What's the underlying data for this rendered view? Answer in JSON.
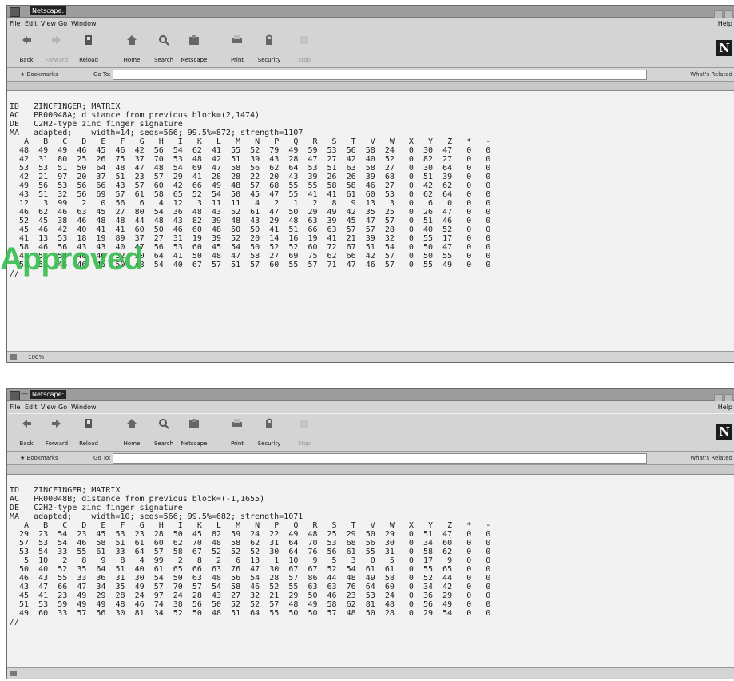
{
  "window_top": {
    "title": "Netscape:",
    "menu": [
      "File",
      "Edit",
      "View",
      "Go",
      "Window"
    ],
    "help": "Help",
    "toolbar": [
      {
        "label": "Back",
        "icon": "back-arrow-icon",
        "enabled": true
      },
      {
        "label": "Forward",
        "icon": "forward-arrow-icon",
        "enabled": false
      },
      {
        "label": "Reload",
        "icon": "reload-icon",
        "enabled": true
      },
      {
        "label": "Home",
        "icon": "home-icon",
        "enabled": true
      },
      {
        "label": "Search",
        "icon": "search-icon",
        "enabled": true
      },
      {
        "label": "Netscape",
        "icon": "netscape-icon",
        "enabled": true
      },
      {
        "label": "Print",
        "icon": "print-icon",
        "enabled": true
      },
      {
        "label": "Security",
        "icon": "security-lock-icon",
        "enabled": true
      },
      {
        "label": "Stop",
        "icon": "stop-icon",
        "enabled": false
      }
    ],
    "bookmarks": "Bookmarks",
    "goto": "Go To:",
    "related": "What's Related",
    "status": "100%",
    "header": [
      "ID   ZINCFINGER; MATRIX",
      "AC   PR00048A; distance from previous block=(2,1474)",
      "DE   C2H2-type zinc finger signature",
      "MA   adapted;    width=14; seqs=566; 99.5%=872; strength=1107"
    ],
    "columns": [
      "A",
      "B",
      "C",
      "D",
      "E",
      "F",
      "G",
      "H",
      "I",
      "K",
      "L",
      "M",
      "N",
      "P",
      "Q",
      "R",
      "S",
      "T",
      "V",
      "W",
      "X",
      "Y",
      "Z",
      "*",
      "-"
    ],
    "rows": [
      [
        "48",
        "49",
        "49",
        "46",
        "45",
        "46",
        "42",
        "56",
        "54",
        "62",
        "41",
        "55",
        "52",
        "79",
        "49",
        "59",
        "53",
        "56",
        "58",
        "24",
        "0",
        "30",
        "47",
        "0",
        "0"
      ],
      [
        "42",
        "31",
        "80",
        "25",
        "26",
        "75",
        "37",
        "70",
        "53",
        "48",
        "42",
        "51",
        "39",
        "43",
        "28",
        "47",
        "27",
        "42",
        "40",
        "52",
        "0",
        "82",
        "27",
        "0",
        "0"
      ],
      [
        "53",
        "53",
        "51",
        "50",
        "64",
        "48",
        "47",
        "48",
        "54",
        "69",
        "47",
        "58",
        "56",
        "62",
        "64",
        "53",
        "51",
        "63",
        "58",
        "27",
        "0",
        "30",
        "64",
        "0",
        "0"
      ],
      [
        "42",
        "21",
        "97",
        "20",
        "37",
        "51",
        "23",
        "57",
        "29",
        "41",
        "28",
        "28",
        "22",
        "20",
        "43",
        "39",
        "26",
        "26",
        "39",
        "68",
        "0",
        "51",
        "39",
        "0",
        "0"
      ],
      [
        "49",
        "56",
        "53",
        "56",
        "66",
        "43",
        "57",
        "60",
        "42",
        "66",
        "49",
        "48",
        "57",
        "68",
        "55",
        "55",
        "58",
        "58",
        "46",
        "27",
        "0",
        "42",
        "62",
        "0",
        "0"
      ],
      [
        "43",
        "51",
        "32",
        "56",
        "69",
        "57",
        "61",
        "58",
        "65",
        "52",
        "54",
        "50",
        "45",
        "47",
        "55",
        "41",
        "41",
        "61",
        "60",
        "53",
        "0",
        "62",
        "64",
        "0",
        "0"
      ],
      [
        "12",
        "3",
        "99",
        "2",
        "0",
        "56",
        "6",
        "4",
        "12",
        "3",
        "11",
        "11",
        "4",
        "2",
        "1",
        "2",
        "8",
        "9",
        "13",
        "3",
        "0",
        "6",
        "0",
        "0",
        "0"
      ],
      [
        "46",
        "62",
        "46",
        "63",
        "45",
        "27",
        "80",
        "54",
        "36",
        "48",
        "43",
        "52",
        "61",
        "47",
        "50",
        "29",
        "49",
        "42",
        "35",
        "25",
        "0",
        "26",
        "47",
        "0",
        "0"
      ],
      [
        "52",
        "45",
        "38",
        "46",
        "48",
        "48",
        "44",
        "48",
        "43",
        "82",
        "39",
        "48",
        "43",
        "29",
        "48",
        "63",
        "39",
        "45",
        "47",
        "57",
        "0",
        "51",
        "46",
        "0",
        "0"
      ],
      [
        "45",
        "46",
        "42",
        "40",
        "41",
        "41",
        "60",
        "50",
        "46",
        "60",
        "48",
        "50",
        "50",
        "41",
        "51",
        "66",
        "63",
        "57",
        "57",
        "28",
        "0",
        "40",
        "52",
        "0",
        "0"
      ],
      [
        "41",
        "13",
        "53",
        "18",
        "19",
        "89",
        "37",
        "27",
        "31",
        "19",
        "39",
        "52",
        "20",
        "14",
        "16",
        "19",
        "41",
        "21",
        "39",
        "32",
        "0",
        "55",
        "17",
        "0",
        "0"
      ],
      [
        "58",
        "46",
        "56",
        "43",
        "43",
        "40",
        "47",
        "56",
        "53",
        "60",
        "45",
        "54",
        "50",
        "52",
        "52",
        "60",
        "72",
        "67",
        "51",
        "54",
        "0",
        "50",
        "47",
        "0",
        "0"
      ],
      [
        "45",
        "51",
        "58",
        "46",
        "46",
        "52",
        "30",
        "64",
        "41",
        "50",
        "48",
        "47",
        "58",
        "27",
        "69",
        "75",
        "62",
        "66",
        "42",
        "57",
        "0",
        "50",
        "55",
        "0",
        "0"
      ],
      [
        "54",
        "51",
        "46",
        "46",
        "45",
        "50",
        "48",
        "54",
        "40",
        "67",
        "57",
        "51",
        "57",
        "60",
        "55",
        "57",
        "71",
        "47",
        "46",
        "57",
        "0",
        "55",
        "49",
        "0",
        "0"
      ]
    ],
    "end": "//"
  },
  "window_bottom": {
    "title": "Netscape:",
    "menu": [
      "File",
      "Edit",
      "View",
      "Go",
      "Window"
    ],
    "help": "Help",
    "toolbar": [
      {
        "label": "Back",
        "icon": "back-arrow-icon",
        "enabled": true
      },
      {
        "label": "Forward",
        "icon": "forward-arrow-icon",
        "enabled": true
      },
      {
        "label": "Reload",
        "icon": "reload-icon",
        "enabled": true
      },
      {
        "label": "Home",
        "icon": "home-icon",
        "enabled": true
      },
      {
        "label": "Search",
        "icon": "search-icon",
        "enabled": true
      },
      {
        "label": "Netscape",
        "icon": "netscape-icon",
        "enabled": true
      },
      {
        "label": "Print",
        "icon": "print-icon",
        "enabled": true
      },
      {
        "label": "Security",
        "icon": "security-lock-icon",
        "enabled": true
      },
      {
        "label": "Stop",
        "icon": "stop-icon",
        "enabled": false
      }
    ],
    "bookmarks": "Bookmarks",
    "goto": "Go To:",
    "related": "What's Related",
    "status": "",
    "header": [
      "ID   ZINCFINGER; MATRIX",
      "AC   PR00048B; distance from previous block=(-1,1655)",
      "DE   C2H2-type zinc finger signature",
      "MA   adapted;    width=10; seqs=566; 99.5%=682; strength=1071"
    ],
    "columns": [
      "A",
      "B",
      "C",
      "D",
      "E",
      "F",
      "G",
      "H",
      "I",
      "K",
      "L",
      "M",
      "N",
      "P",
      "Q",
      "R",
      "S",
      "T",
      "V",
      "W",
      "X",
      "Y",
      "Z",
      "*",
      "-"
    ],
    "rows": [
      [
        "29",
        "23",
        "54",
        "23",
        "45",
        "53",
        "23",
        "28",
        "50",
        "45",
        "82",
        "59",
        "24",
        "22",
        "49",
        "48",
        "25",
        "29",
        "50",
        "29",
        "0",
        "51",
        "47",
        "0",
        "0"
      ],
      [
        "57",
        "53",
        "54",
        "46",
        "58",
        "51",
        "61",
        "60",
        "62",
        "70",
        "48",
        "58",
        "62",
        "31",
        "64",
        "70",
        "53",
        "68",
        "56",
        "30",
        "0",
        "34",
        "60",
        "0",
        "0"
      ],
      [
        "53",
        "54",
        "33",
        "55",
        "61",
        "33",
        "64",
        "57",
        "58",
        "67",
        "52",
        "52",
        "52",
        "30",
        "64",
        "76",
        "56",
        "61",
        "55",
        "31",
        "0",
        "58",
        "62",
        "0",
        "0"
      ],
      [
        "5",
        "10",
        "2",
        "8",
        "9",
        "8",
        "4",
        "99",
        "2",
        "8",
        "2",
        "6",
        "13",
        "1",
        "10",
        "9",
        "5",
        "3",
        "0",
        "5",
        "0",
        "17",
        "9",
        "0",
        "0"
      ],
      [
        "50",
        "40",
        "52",
        "35",
        "64",
        "51",
        "40",
        "61",
        "65",
        "66",
        "63",
        "76",
        "47",
        "30",
        "67",
        "67",
        "52",
        "54",
        "61",
        "61",
        "0",
        "55",
        "65",
        "0",
        "0"
      ],
      [
        "46",
        "43",
        "55",
        "33",
        "36",
        "31",
        "30",
        "54",
        "50",
        "63",
        "48",
        "56",
        "54",
        "28",
        "57",
        "86",
        "44",
        "48",
        "49",
        "58",
        "0",
        "52",
        "44",
        "0",
        "0"
      ],
      [
        "43",
        "47",
        "66",
        "47",
        "34",
        "35",
        "49",
        "57",
        "70",
        "57",
        "54",
        "58",
        "46",
        "52",
        "55",
        "63",
        "63",
        "76",
        "64",
        "60",
        "0",
        "34",
        "42",
        "0",
        "0"
      ],
      [
        "45",
        "41",
        "23",
        "49",
        "29",
        "28",
        "24",
        "97",
        "24",
        "28",
        "43",
        "27",
        "32",
        "21",
        "29",
        "50",
        "46",
        "23",
        "53",
        "24",
        "0",
        "36",
        "29",
        "0",
        "0"
      ],
      [
        "51",
        "53",
        "59",
        "49",
        "49",
        "48",
        "46",
        "74",
        "38",
        "56",
        "50",
        "52",
        "52",
        "57",
        "48",
        "49",
        "58",
        "62",
        "81",
        "48",
        "0",
        "56",
        "49",
        "0",
        "0"
      ],
      [
        "49",
        "60",
        "33",
        "57",
        "56",
        "30",
        "81",
        "34",
        "52",
        "50",
        "48",
        "51",
        "64",
        "55",
        "50",
        "50",
        "57",
        "48",
        "50",
        "28",
        "0",
        "29",
        "54",
        "0",
        "0"
      ]
    ],
    "end": "//"
  },
  "stamp_text": "Approved"
}
